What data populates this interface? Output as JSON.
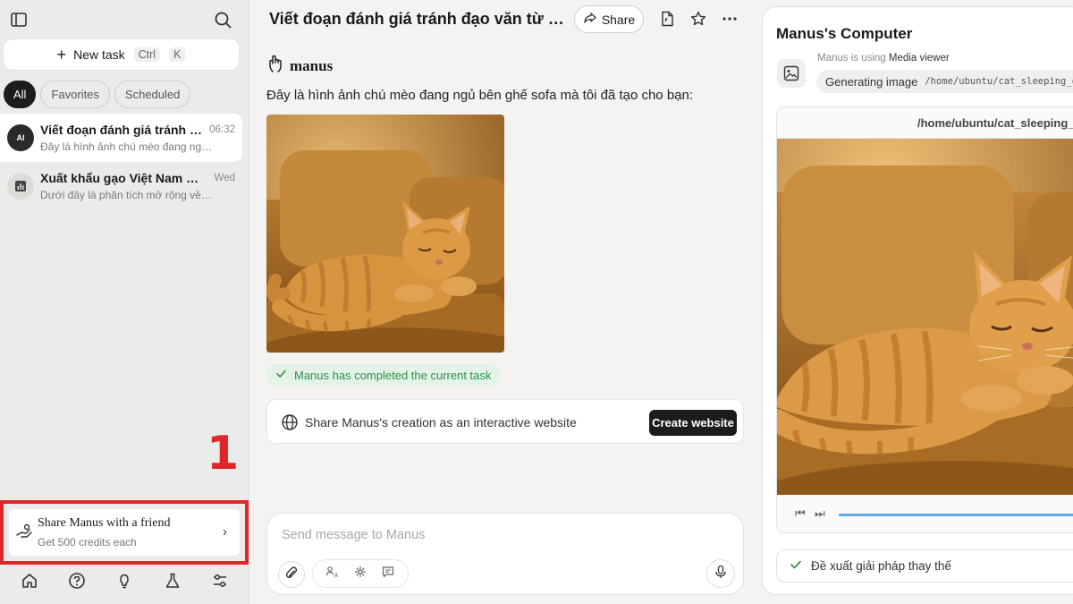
{
  "sidebar": {
    "new_task_label": "New task",
    "shortcut_ctrl": "Ctrl",
    "shortcut_key": "K",
    "filters": [
      {
        "label": "All",
        "active": true
      },
      {
        "label": "Favorites",
        "active": false
      },
      {
        "label": "Scheduled",
        "active": false
      }
    ],
    "tasks": [
      {
        "title": "Viết đoạn đánh giá tránh đạ...",
        "time": "06:32",
        "subtitle": "Đây là hình ảnh chú mèo đang ngủ ...",
        "icon": "ai-avatar-icon",
        "selected": true
      },
      {
        "title": "Xuất khẩu gạo Việt Nam nửa ...",
        "time": "Wed",
        "subtitle": "Dưới đây là phân tích mở rộng về ti...",
        "icon": "chart-icon",
        "selected": false
      }
    ],
    "marker_number": "1",
    "share_friend": {
      "title": "Share Manus with a friend",
      "subtitle": "Get 500 credits each"
    }
  },
  "main": {
    "chat_title": "Viết đoạn đánh giá tránh đạo văn từ thô...",
    "share_label": "Share",
    "brand_name": "manus",
    "message": "Đây là hình ảnh chú mèo đang ngủ bên ghế sofa mà tôi đã tạo cho bạn:",
    "status": "Manus has completed the current task",
    "website_prompt": "Share Manus's creation as an interactive website",
    "website_button": "Create website",
    "composer_placeholder": "Send message to Manus"
  },
  "computer": {
    "title": "Manus's Computer",
    "using_prefix": "Manus is using",
    "using_tool": "Media viewer",
    "action": "Generating image",
    "action_path": "/home/ubuntu/cat_sleeping_o",
    "viewer_path": "/home/ubuntu/cat_sleeping_",
    "alt_solution": "Đề xuất giải pháp thay thế"
  },
  "colors": {
    "accent_red": "#e0262b",
    "success_green": "#2f8f4a",
    "progress_blue": "#5fa8e8"
  }
}
